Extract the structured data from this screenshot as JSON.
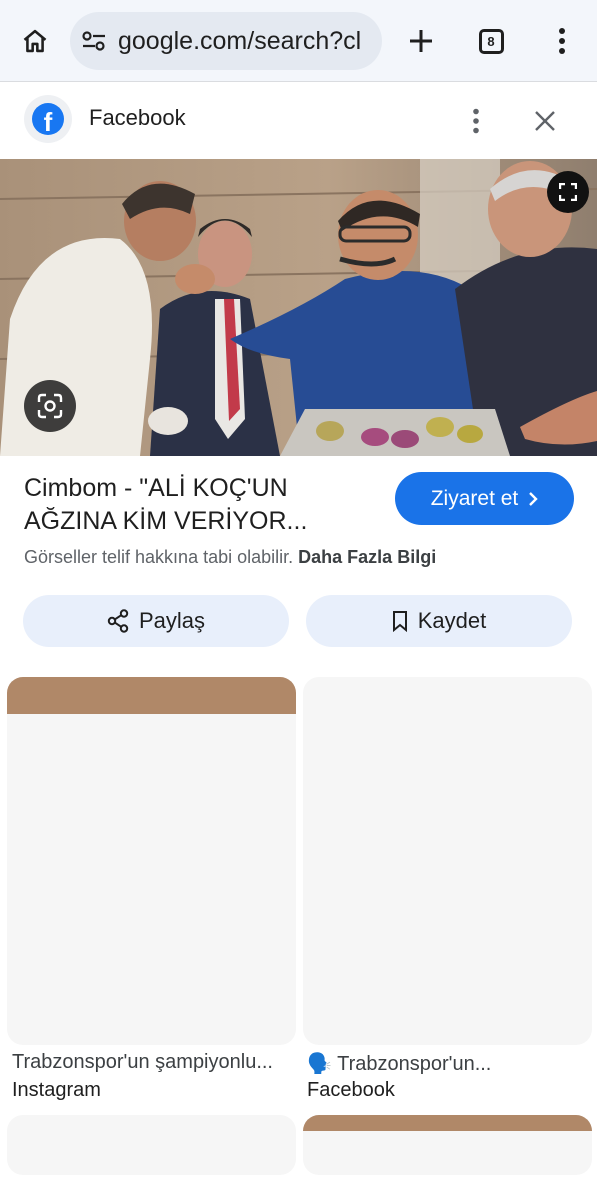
{
  "browser": {
    "url": "google.com/search?cl",
    "tab_count": "8",
    "icons": [
      "home-icon",
      "site-settings-icon",
      "plus-icon",
      "tabs-icon",
      "more-vert-icon"
    ]
  },
  "source": {
    "name": "Facebook",
    "logo_letter": "f",
    "brand_color": "#1877f2"
  },
  "result": {
    "title": "Cimbom - \"ALİ KOÇ'UN AĞZINA KİM VERİYOR...",
    "visit_label": "Ziyaret et",
    "copyright_text": "Görseller telif hakkına tabi olabilir.",
    "more_info_label": "Daha Fazla Bilgi",
    "share_label": "Paylaş",
    "save_label": "Kaydet",
    "accent": "#1a73e8"
  },
  "related": [
    {
      "title": "Trabzonspor'un şampiyonlu...",
      "source": "Instagram"
    },
    {
      "title": "🗣️ Trabzonspor'un...",
      "source": "Facebook"
    }
  ]
}
